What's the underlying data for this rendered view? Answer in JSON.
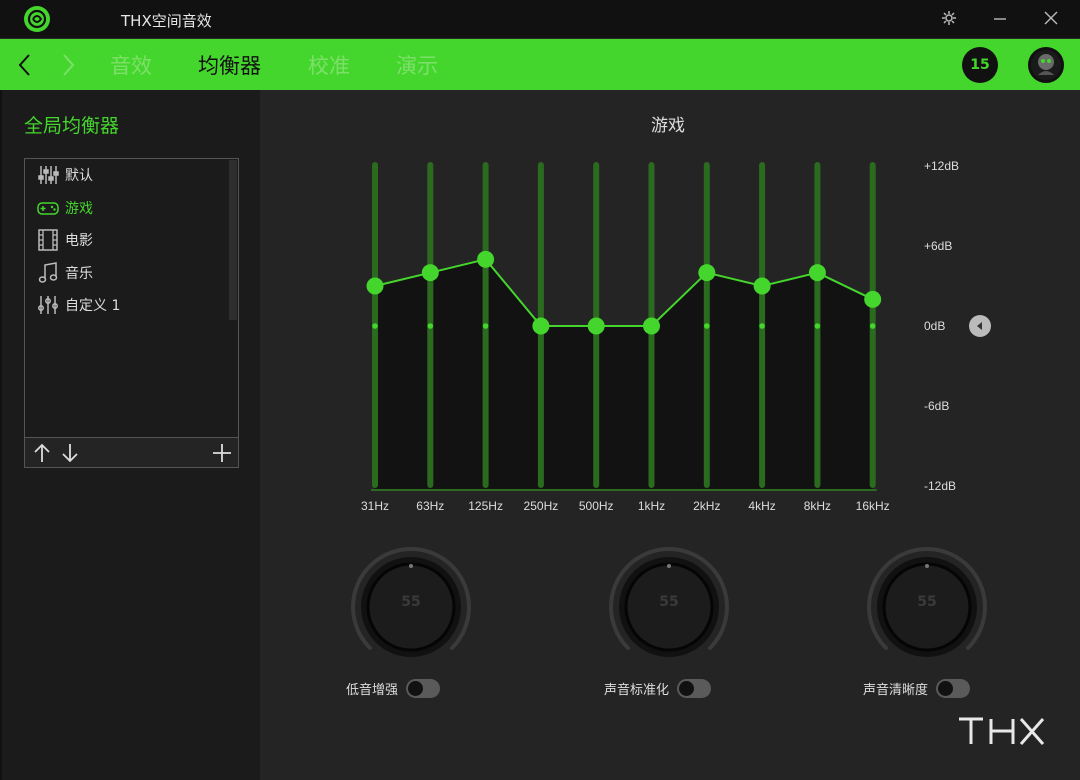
{
  "app": {
    "title": "THX空间音效"
  },
  "nav": {
    "tabs": [
      {
        "label": "音效",
        "active": false
      },
      {
        "label": "均衡器",
        "active": true
      },
      {
        "label": "校准",
        "active": false
      },
      {
        "label": "演示",
        "active": false
      }
    ],
    "notification_count": "15"
  },
  "sidebar": {
    "title": "全局均衡器",
    "presets": [
      {
        "label": "默认",
        "icon": "sliders-icon",
        "selected": false
      },
      {
        "label": "游戏",
        "icon": "gamepad-icon",
        "selected": true
      },
      {
        "label": "电影",
        "icon": "film-icon",
        "selected": false
      },
      {
        "label": "音乐",
        "icon": "music-note-icon",
        "selected": false
      },
      {
        "label": "自定义 1",
        "icon": "custom-sliders-icon",
        "selected": false
      }
    ]
  },
  "equalizer": {
    "title": "游戏",
    "db_labels": [
      "+12dB",
      "+6dB",
      "0dB",
      "-6dB",
      "-12dB"
    ],
    "bands": [
      "31Hz",
      "63Hz",
      "125Hz",
      "250Hz",
      "500Hz",
      "1kHz",
      "2kHz",
      "4kHz",
      "8kHz",
      "16kHz"
    ],
    "gains_db": [
      3,
      4,
      5,
      0,
      0,
      0,
      4,
      3,
      4,
      2
    ],
    "range_db": [
      -12,
      12
    ],
    "accent_color": "#44d62c"
  },
  "knobs": [
    {
      "value": "55",
      "label": "低音增强",
      "enabled": false
    },
    {
      "value": "55",
      "label": "声音标准化",
      "enabled": false
    },
    {
      "value": "55",
      "label": "声音清晰度",
      "enabled": false
    }
  ],
  "brand": {
    "logo_text": "THX"
  }
}
